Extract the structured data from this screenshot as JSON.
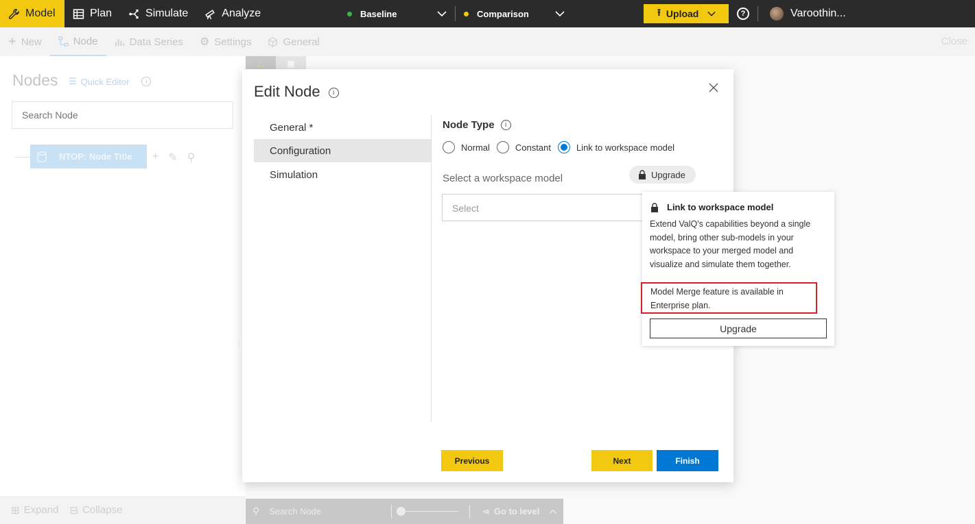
{
  "topnav": {
    "items": [
      {
        "label": "Model",
        "icon": "wrench-icon",
        "active": true
      },
      {
        "label": "Plan",
        "icon": "table-icon",
        "active": false
      },
      {
        "label": "Simulate",
        "icon": "branch-icon",
        "active": false
      },
      {
        "label": "Analyze",
        "icon": "telescope-icon",
        "active": false
      }
    ],
    "baseline": {
      "label": "Baseline",
      "dot_color": "#3ab54a"
    },
    "comparison": {
      "label": "Comparison",
      "dot_color": "#f2c811"
    },
    "upload_label": "Upload",
    "user_name": "Varoothin..."
  },
  "subbar": {
    "items": [
      {
        "label": "New",
        "icon": "plus-icon"
      },
      {
        "label": "Node",
        "icon": "node-icon"
      },
      {
        "label": "Data Series",
        "icon": "bar-chart-icon"
      },
      {
        "label": "Settings",
        "icon": "gear-icon"
      },
      {
        "label": "General",
        "icon": "cube-icon"
      }
    ],
    "close_label": "Close"
  },
  "left": {
    "title": "Nodes",
    "quick_editor": "Quick Editor",
    "search_placeholder": "Search Node",
    "node_label": "NTOP: Node Title",
    "expand_label": "Expand",
    "collapse_label": "Collapse"
  },
  "canvas": {
    "search_placeholder": "Search Node",
    "goto_label": "Go to level"
  },
  "modal": {
    "title": "Edit Node",
    "nav": [
      "General *",
      "Configuration",
      "Simulation"
    ],
    "node_type_label": "Node Type",
    "radios": [
      "Normal",
      "Constant",
      "Link to workspace model"
    ],
    "selected_radio": "Link to workspace model",
    "workspace_label": "Select a workspace model",
    "upgrade_pill": "Upgrade",
    "select_placeholder": "Select",
    "prev_label": "Previous",
    "next_label": "Next",
    "finish_label": "Finish"
  },
  "popover": {
    "title": "Link to workspace model",
    "description": "Extend ValQ's capabilities beyond a single model, bring other sub-models in your workspace to your merged model and visualize and simulate them together.",
    "note": "Model Merge feature is available in Enterprise plan.",
    "button": "Upgrade"
  }
}
